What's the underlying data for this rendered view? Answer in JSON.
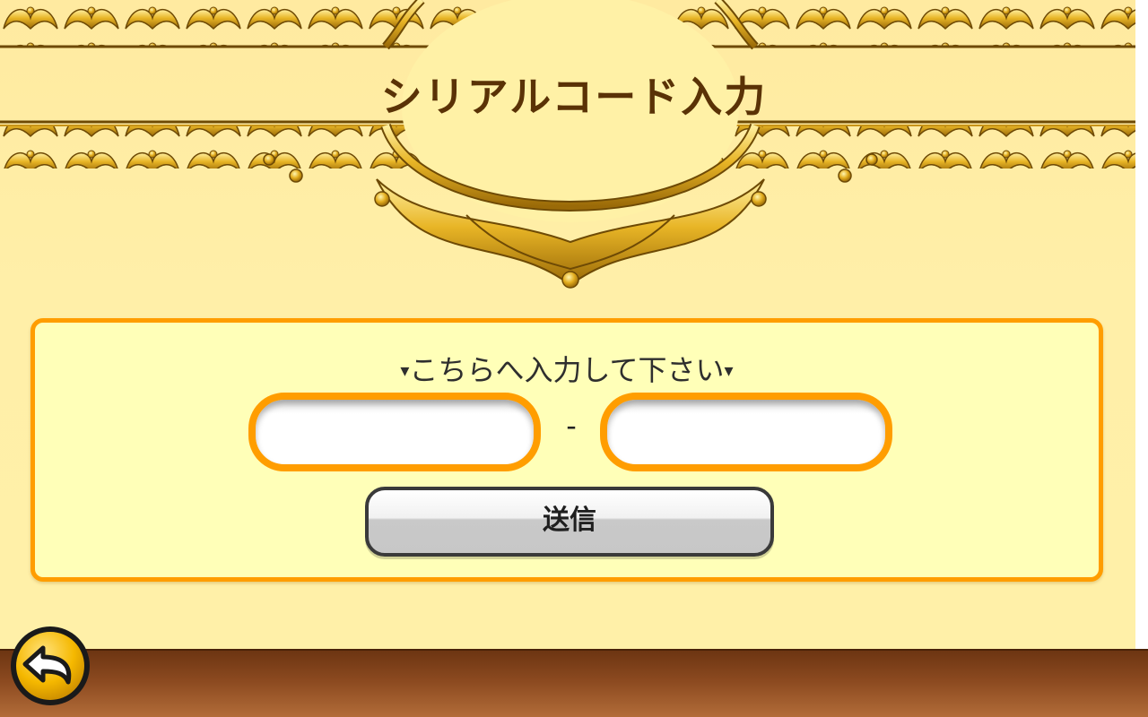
{
  "header": {
    "title": "シリアルコード入力"
  },
  "form": {
    "instruction": "こちらへ入力して下さい",
    "instruction_marker": "▾",
    "code_part_1": {
      "value": "",
      "placeholder": ""
    },
    "code_part_2": {
      "value": "",
      "placeholder": ""
    },
    "separator": "-",
    "submit_label": "送信"
  },
  "navigation": {
    "back_icon": "back-arrow-icon"
  },
  "colors": {
    "accent_orange": "#ff9d00",
    "gold_ornament": "#d9a31a",
    "title_brown": "#5a3206",
    "panel_background": "#ffffb8",
    "page_background": "#fff0a8",
    "bottom_bar": "#8c4a20"
  }
}
